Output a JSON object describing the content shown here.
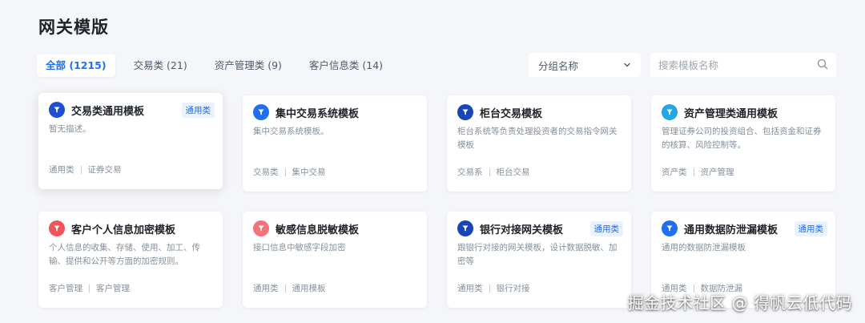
{
  "page": {
    "title": "网关模版"
  },
  "tabs": [
    {
      "label": "全部 (1215)",
      "active": true
    },
    {
      "label": "交易类 (21)",
      "active": false
    },
    {
      "label": "资产管理类 (9)",
      "active": false
    },
    {
      "label": "客户信息类 (14)",
      "active": false
    }
  ],
  "filter": {
    "group_select": "分组名称",
    "search_placeholder": "搜索模板名称"
  },
  "cards": [
    {
      "title": "交易类通用模板",
      "badge": "通用类",
      "desc": "暂无描述。",
      "tag1": "通用类",
      "tag2": "证券交易",
      "icon_color": "#1f4fd1"
    },
    {
      "title": "集中交易系统模板",
      "badge": "",
      "desc": "集中交易系统模板。",
      "tag1": "交易类",
      "tag2": "集中交易",
      "icon_color": "#1f6ff2"
    },
    {
      "title": "柜台交易模板",
      "badge": "",
      "desc": "柜台系统等负责处理投资者的交易指令网关模板",
      "tag1": "交易系",
      "tag2": "柜台交易",
      "icon_color": "#1a45b8"
    },
    {
      "title": "资产管理类通用模板",
      "badge": "",
      "desc": "管理证券公司的投资组合、包括资金和证券的核算、风险控制等。",
      "tag1": "资产类",
      "tag2": "资产管理",
      "icon_color": "#22a6e8"
    },
    {
      "title": "客户个人信息加密模板",
      "badge": "",
      "desc": "个人信息的收集、存储、使用、加工、传输、提供和公开等方面的加密规则。",
      "tag1": "客户管理",
      "tag2": "客户管理",
      "icon_color": "#f2545b"
    },
    {
      "title": "敏感信息脱敏模板",
      "badge": "",
      "desc": "接口信息中敏感字段加密",
      "tag1": "通用类",
      "tag2": "通用模板",
      "icon_color": "#f2737a"
    },
    {
      "title": "银行对接网关模板",
      "badge": "通用类",
      "desc": "跟银行对接的网关模板，设计数据脱敏、加密等",
      "tag1": "通用类",
      "tag2": "银行对接",
      "icon_color": "#1a45b8"
    },
    {
      "title": "通用数据防泄漏模板",
      "badge": "通用类",
      "desc": "通用的数据防泄漏模板",
      "tag1": "通用类",
      "tag2": "数据防泄漏",
      "icon_color": "#1f6ff2"
    }
  ],
  "watermark": "掘金技术社区 @ 得帆云低代码",
  "colors": {
    "accent": "#1f6ff2",
    "background": "#f5f6f9",
    "card": "#ffffff",
    "muted_text": "#86909c"
  }
}
